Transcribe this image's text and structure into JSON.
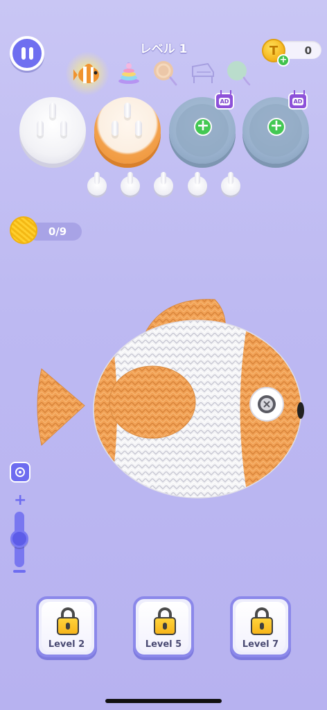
{
  "header": {
    "level_title": "レベル 1",
    "coins": "0"
  },
  "tasks": [
    {
      "icon": "clownfish-icon",
      "active": true
    },
    {
      "icon": "pyramid-toy-icon",
      "active": false
    },
    {
      "icon": "lollipop-icon",
      "active": false
    },
    {
      "icon": "piano-icon",
      "active": false
    },
    {
      "icon": "balloon-icon",
      "active": false
    }
  ],
  "spools": [
    {
      "state": "white-filled"
    },
    {
      "state": "orange-filled"
    },
    {
      "state": "locked-ad",
      "ad_label": "AD"
    },
    {
      "state": "locked-ad",
      "ad_label": "AD"
    }
  ],
  "yarn_progress": {
    "text": "0/9",
    "collected": 0,
    "total": 9
  },
  "zoom_level": 0.4,
  "levels": [
    {
      "label": "Level 2",
      "locked": true
    },
    {
      "label": "Level 5",
      "locked": true
    },
    {
      "label": "Level 7",
      "locked": true
    }
  ],
  "colors": {
    "accent": "#6d6cf0",
    "yarn_orange": "#f2a04a",
    "yarn_white": "#f2f2f6",
    "add_green": "#3dc94b",
    "ad_purple": "#8b4bd8",
    "coin_gold": "#f4b21a"
  }
}
